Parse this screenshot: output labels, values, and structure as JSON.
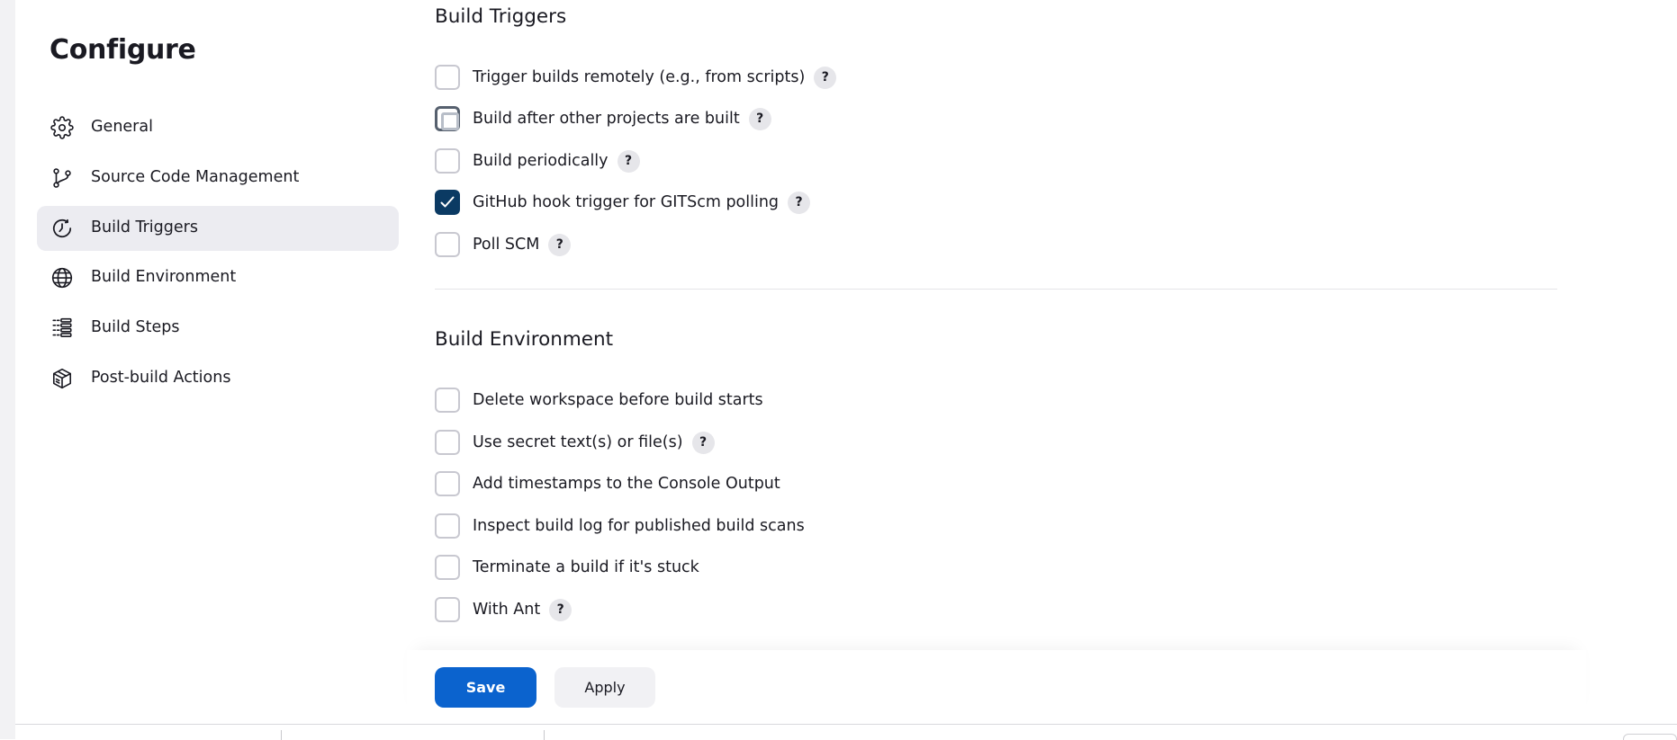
{
  "sidebar": {
    "title": "Configure",
    "items": [
      {
        "label": "General",
        "icon": "gear-icon"
      },
      {
        "label": "Source Code Management",
        "icon": "git-branch-icon"
      },
      {
        "label": "Build Triggers",
        "icon": "clock-icon",
        "active": true
      },
      {
        "label": "Build Environment",
        "icon": "globe-icon"
      },
      {
        "label": "Build Steps",
        "icon": "list-icon"
      },
      {
        "label": "Post-build Actions",
        "icon": "package-icon"
      }
    ]
  },
  "build_triggers": {
    "title": "Build Triggers",
    "options": [
      {
        "label": "Trigger builds remotely (e.g., from scripts)",
        "checked": false,
        "help": "?"
      },
      {
        "label": "Build after other projects are built",
        "checked": false,
        "help": "?"
      },
      {
        "label": "Build periodically",
        "checked": false,
        "help": "?"
      },
      {
        "label": "GitHub hook trigger for GITScm polling",
        "checked": true,
        "help": "?"
      },
      {
        "label": "Poll SCM",
        "checked": false,
        "help": "?"
      }
    ]
  },
  "build_environment": {
    "title": "Build Environment",
    "options": [
      {
        "label": "Delete workspace before build starts",
        "checked": false
      },
      {
        "label": "Use secret text(s) or file(s)",
        "checked": false,
        "help": "?"
      },
      {
        "label": "Add timestamps to the Console Output",
        "checked": false
      },
      {
        "label": "Inspect build log for published build scans",
        "checked": false
      },
      {
        "label": "Terminate a build if it's stuck",
        "checked": false
      },
      {
        "label": "With Ant",
        "checked": false,
        "help": "?"
      }
    ]
  },
  "actions": {
    "save_label": "Save",
    "apply_label": "Apply"
  },
  "colors": {
    "primary": "#0b63ce",
    "checked": "#0b3a63",
    "active_nav": "#ececf1"
  }
}
